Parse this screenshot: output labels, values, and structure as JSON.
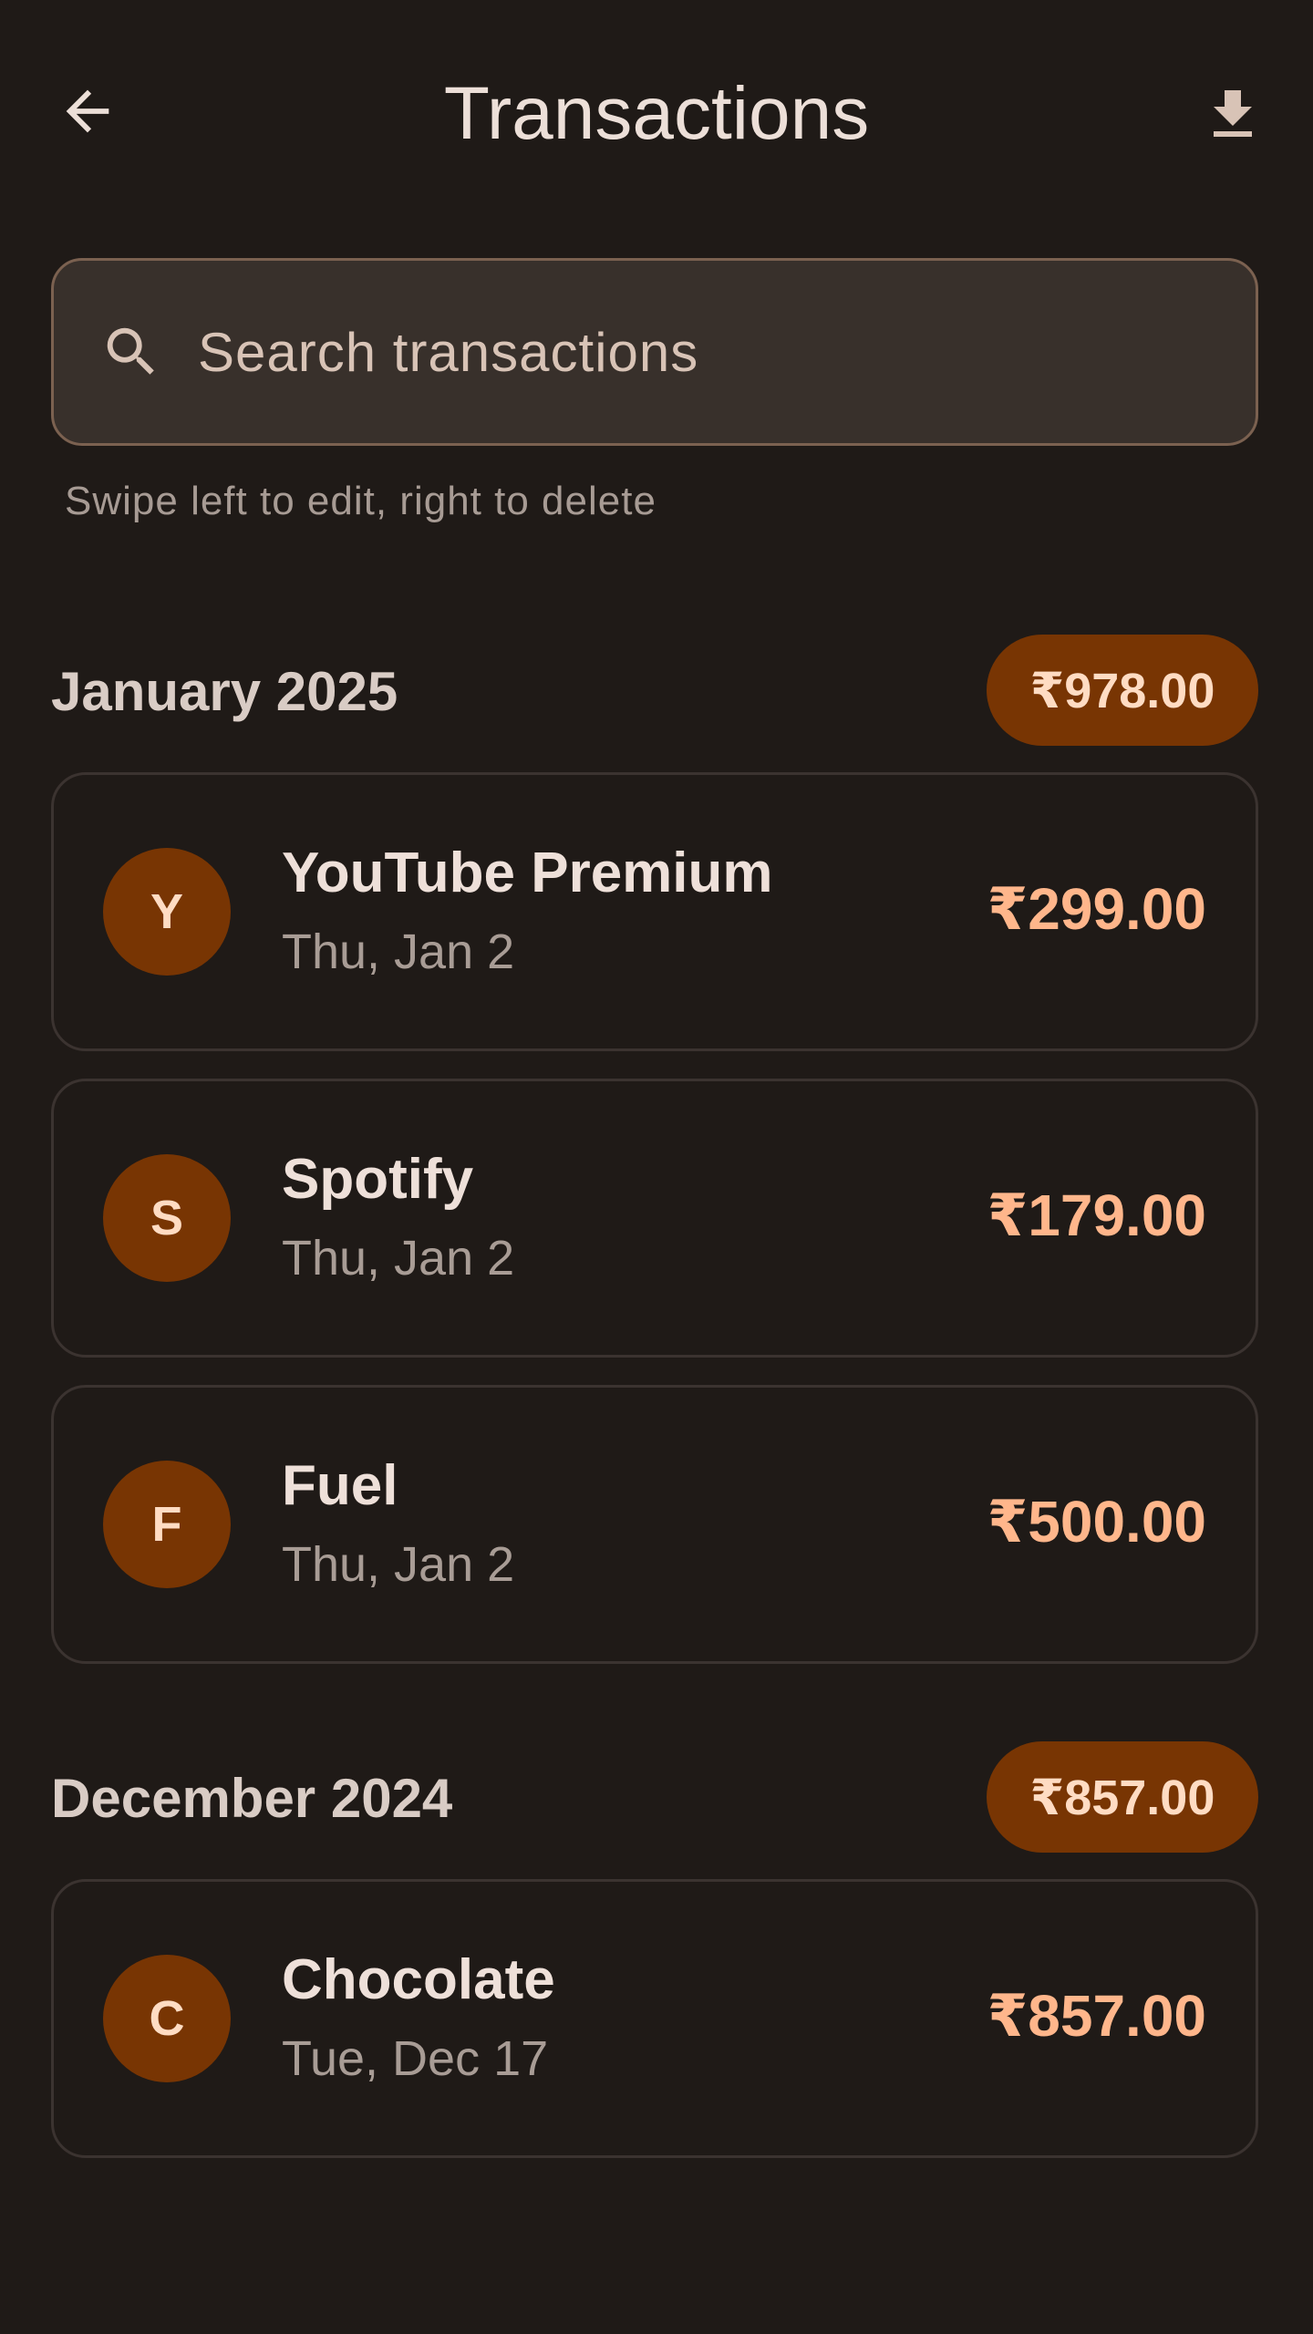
{
  "header": {
    "title": "Transactions",
    "back_icon": "arrow-back-icon",
    "download_icon": "download-icon"
  },
  "search": {
    "placeholder": "Search transactions",
    "value": "",
    "icon": "search-icon"
  },
  "hint": "Swipe left to edit, right to delete",
  "colors": {
    "background": "#1f1a17",
    "accent": "#783503",
    "amount": "#ffb68b"
  },
  "groups": [
    {
      "month": "January 2025",
      "total": "₹978.00",
      "items": [
        {
          "initial": "Y",
          "name": "YouTube Premium",
          "date": "Thu, Jan 2",
          "amount": "₹299.00"
        },
        {
          "initial": "S",
          "name": "Spotify",
          "date": "Thu, Jan 2",
          "amount": "₹179.00"
        },
        {
          "initial": "F",
          "name": "Fuel",
          "date": "Thu, Jan 2",
          "amount": "₹500.00"
        }
      ]
    },
    {
      "month": "December 2024",
      "total": "₹857.00",
      "items": [
        {
          "initial": "C",
          "name": "Chocolate",
          "date": "Tue, Dec 17",
          "amount": "₹857.00"
        }
      ]
    }
  ]
}
